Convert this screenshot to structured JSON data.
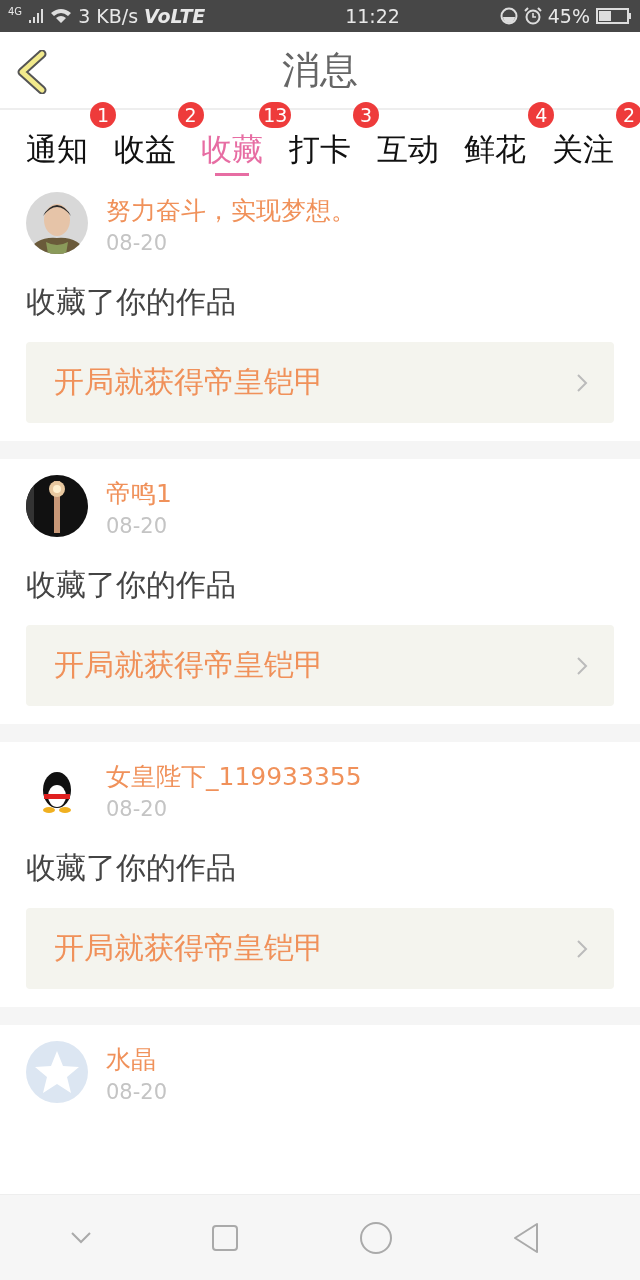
{
  "status_bar": {
    "network": "4G",
    "speed": "3 KB/s",
    "volte": "VoLTE",
    "time": "11:22",
    "battery": "45%"
  },
  "header": {
    "title": "消息"
  },
  "tabs": [
    {
      "label": "通知",
      "badge": "1",
      "selected": false
    },
    {
      "label": "收益",
      "badge": "2",
      "selected": false
    },
    {
      "label": "收藏",
      "badge": "13",
      "selected": true
    },
    {
      "label": "打卡",
      "badge": "3",
      "selected": false
    },
    {
      "label": "互动",
      "selected": false
    },
    {
      "label": "鲜花",
      "badge": "4",
      "selected": false
    },
    {
      "label": "关注",
      "badge": "2",
      "selected": false
    }
  ],
  "messages": [
    {
      "name": "努力奋斗，实现梦想。",
      "date": "08-20",
      "action": "收藏了你的作品",
      "work": "开局就获得帝皇铠甲"
    },
    {
      "name": "帝鸣1",
      "date": "08-20",
      "action": "收藏了你的作品",
      "work": "开局就获得帝皇铠甲"
    },
    {
      "name": "女皇陛下_119933355",
      "date": "08-20",
      "action": "收藏了你的作品",
      "work": "开局就获得帝皇铠甲"
    },
    {
      "avatar": {
        "kind": "default"
      },
      "name": "水晶",
      "date": "08-20"
    }
  ]
}
